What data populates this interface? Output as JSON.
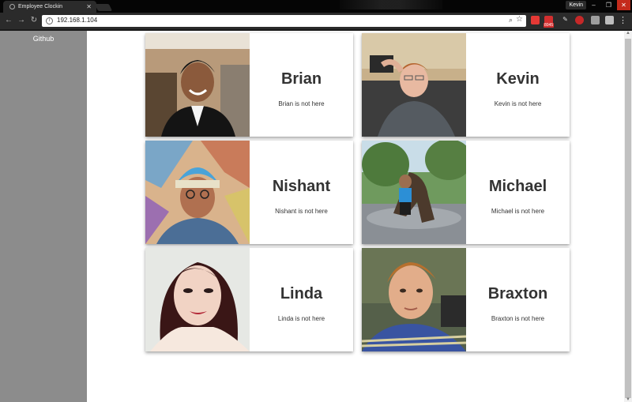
{
  "browser": {
    "tab_title": "Employee Clockin",
    "url": "192.168.1.104",
    "profile_name": "Kevin",
    "mail_badge": "8045"
  },
  "sidebar": {
    "github_link": "Github"
  },
  "employees": [
    {
      "name": "Brian",
      "status": "Brian is not here"
    },
    {
      "name": "Kevin",
      "status": "Kevin is not here"
    },
    {
      "name": "Nishant",
      "status": "Nishant is not here"
    },
    {
      "name": "Michael",
      "status": "Michael is not here"
    },
    {
      "name": "Linda",
      "status": "Linda is not here"
    },
    {
      "name": "Braxton",
      "status": "Braxton is not here"
    }
  ],
  "colors": {
    "sidebar_bg": "#8c8c8c",
    "card_text": "#333333",
    "chrome_dark": "#2b2b2b"
  }
}
